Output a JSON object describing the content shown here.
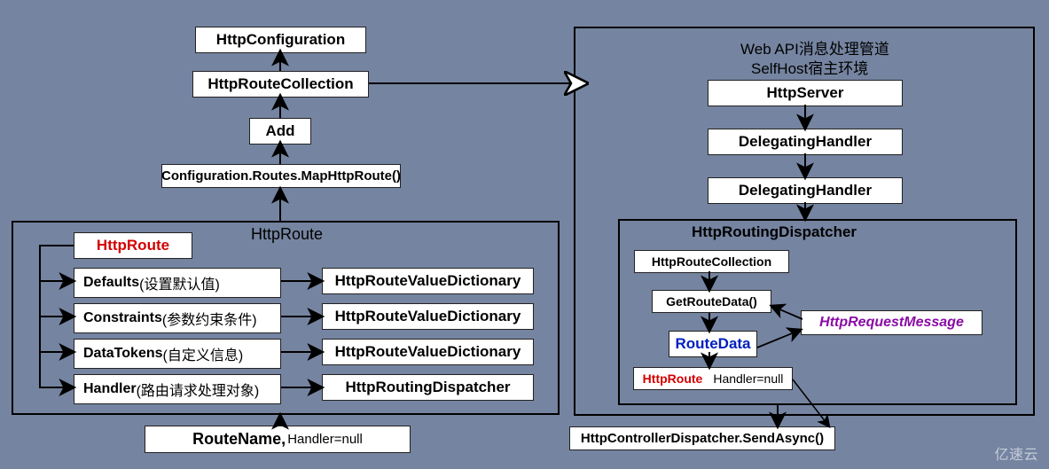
{
  "left": {
    "httpConfiguration": "HttpConfiguration",
    "httpRouteCollection": "HttpRouteCollection",
    "add": "Add",
    "mapHttpRoute": "Configuration.Routes.MapHttpRoute()",
    "httpRouteTitle": "HttpRoute",
    "httpRoute": "HttpRoute",
    "defaults": "Defaults",
    "defaultsNote": "(设置默认值)",
    "constraints": "Constraints",
    "constraintsNote": "(参数约束条件)",
    "dataTokens": "DataTokens",
    "dataTokensNote": "(自定义信息)",
    "handler": "Handler",
    "handlerNote": "(路由请求处理对象)",
    "dict1": "HttpRouteValueDictionary",
    "dict2": "HttpRouteValueDictionary",
    "dict3": "HttpRouteValueDictionary",
    "routingDispatcher": "HttpRoutingDispatcher",
    "routeName": "RouteName,",
    "handlerNull": "Handler=null"
  },
  "right": {
    "pipelineTitle1": "Web API消息处理管道",
    "pipelineTitle2": "SelfHost宿主环境",
    "httpServer": "HttpServer",
    "delegating1": "DelegatingHandler",
    "delegating2": "DelegatingHandler",
    "dispatcherTitle": "HttpRoutingDispatcher",
    "httpRouteCollection": "HttpRouteCollection",
    "getRouteData": "GetRouteData()",
    "routeData": "RouteData",
    "httpRoute": "HttpRoute",
    "handlerNull": "Handler=null",
    "requestMessage": "HttpRequestMessage",
    "controllerDispatcher": "HttpControllerDispatcher.SendAsync()"
  },
  "watermark": "亿速云"
}
